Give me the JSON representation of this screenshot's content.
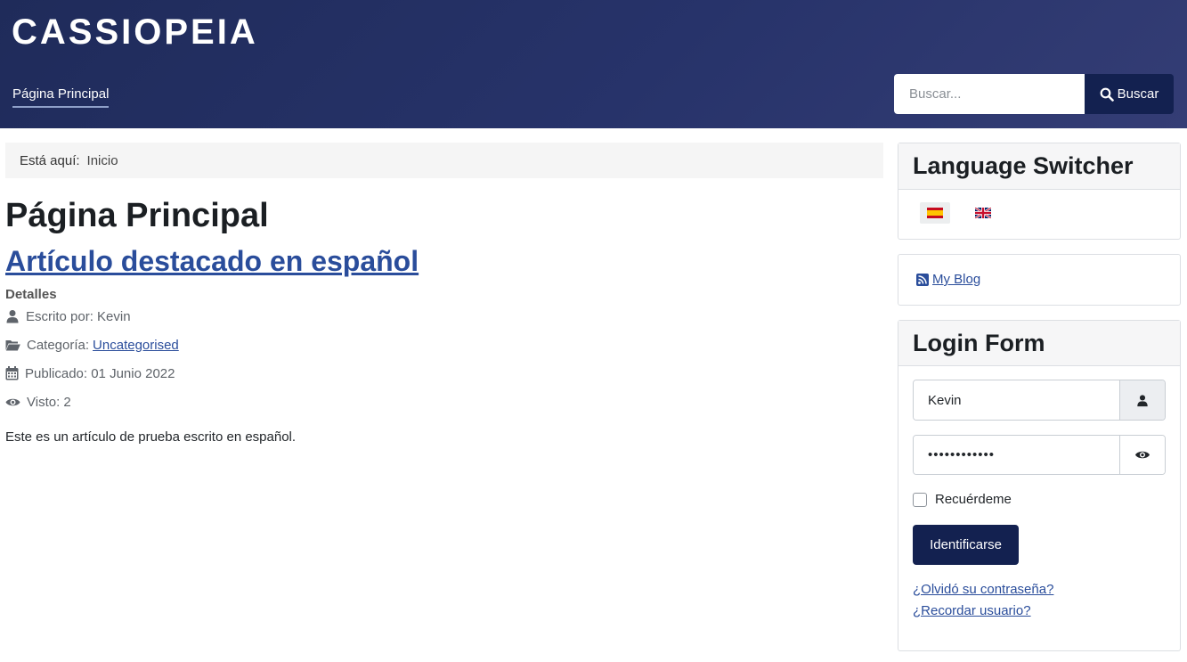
{
  "header": {
    "brand": "CASSIOPEIA",
    "nav": [
      {
        "label": "Página Principal"
      }
    ],
    "search": {
      "placeholder": "Buscar...",
      "button_label": "Buscar"
    }
  },
  "breadcrumb": {
    "label": "Está aquí:",
    "items": [
      "Inicio"
    ]
  },
  "main": {
    "page_title": "Página Principal",
    "article": {
      "title": "Artículo destacado en español",
      "details_label": "Detalles",
      "meta": {
        "author": "Escrito por: Kevin",
        "category_label": "Categoría:",
        "category_value": "Uncategorised",
        "published": "Publicado: 01 Junio 2022",
        "views": "Visto: 2"
      },
      "body": "Este es un artículo de prueba escrito en español."
    }
  },
  "sidebar": {
    "language_switcher": {
      "title": "Language Switcher",
      "languages": [
        "es",
        "gb"
      ]
    },
    "blog": {
      "label": "My Blog"
    },
    "login": {
      "title": "Login Form",
      "username_value": "Kevin",
      "password_value": "••••••••••••",
      "remember_label": "Recuérdeme",
      "submit_label": "Identificarse",
      "forgot_password": "¿Olvidó su contraseña?",
      "forgot_username": "¿Recordar usuario?"
    }
  },
  "colors": {
    "header_bg": "#27336a",
    "button_bg": "#132150",
    "link": "#2a4d9b"
  },
  "icons": [
    "search-icon",
    "user-icon",
    "folder-icon",
    "calendar-icon",
    "eye-icon",
    "rss-icon",
    "flag-es-icon",
    "flag-gb-icon"
  ]
}
